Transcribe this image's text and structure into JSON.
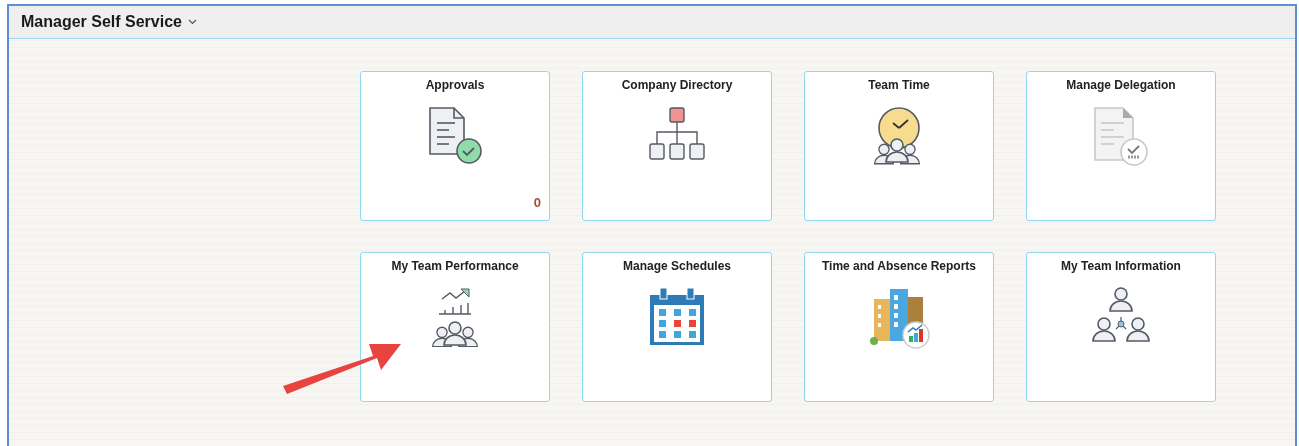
{
  "header": {
    "title": "Manager Self Service"
  },
  "tiles": [
    {
      "title": "Approvals",
      "kind": "approvals",
      "count": "0"
    },
    {
      "title": "Company Directory",
      "kind": "directory"
    },
    {
      "title": "Team Time",
      "kind": "teamtime"
    },
    {
      "title": "Manage Delegation",
      "kind": "delegation"
    },
    {
      "title": "My Team Performance",
      "kind": "performance"
    },
    {
      "title": "Manage Schedules",
      "kind": "schedules"
    },
    {
      "title": "Time and Absence Reports",
      "kind": "reports"
    },
    {
      "title": "My Team Information",
      "kind": "teaminfo"
    }
  ]
}
